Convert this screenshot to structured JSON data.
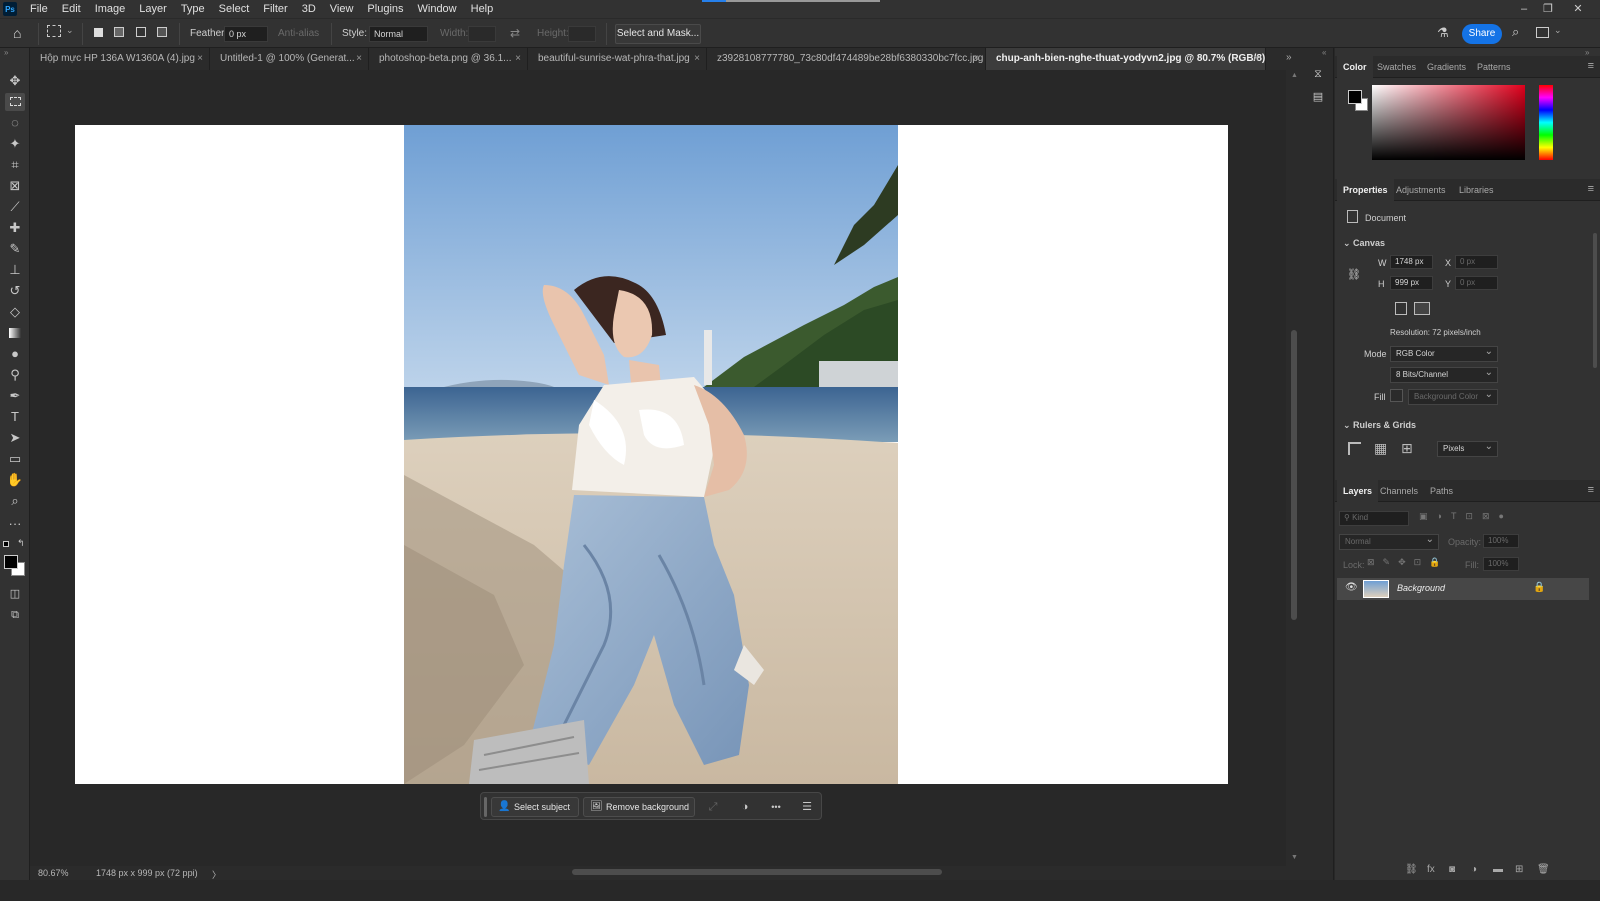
{
  "menu": {
    "app_icon": "Ps",
    "items": [
      "File",
      "Edit",
      "Image",
      "Layer",
      "Type",
      "Select",
      "Filter",
      "3D",
      "View",
      "Plugins",
      "Window",
      "Help"
    ],
    "window_controls": [
      "–",
      "❐",
      "✕"
    ]
  },
  "options_bar": {
    "feather_label": "Feather:",
    "feather_value": "0 px",
    "anti_alias_label": "Anti-alias",
    "style_label": "Style:",
    "style_value": "Normal",
    "width_label": "Width:",
    "height_label": "Height:",
    "select_mask_label": "Select and Mask...",
    "share_label": "Share"
  },
  "tabs": [
    {
      "label": "Hộp mực HP 136A W1360A (4).jpg",
      "active": false
    },
    {
      "label": "Untitled-1 @ 100% (Generat...",
      "active": false
    },
    {
      "label": "photoshop-beta.png @ 36.1...",
      "active": false
    },
    {
      "label": "beautiful-sunrise-wat-phra-that.jpg",
      "active": false
    },
    {
      "label": "z3928108777780_73c80df474489be28bf6380330bc7fcc.jpg",
      "active": false
    },
    {
      "label": "chup-anh-bien-nghe-thuat-yodyvn2.jpg @ 80.7% (RGB/8) *",
      "active": true
    }
  ],
  "tab_close": "×",
  "status": {
    "zoom": "80.67%",
    "doc_info": "1748 px x 999 px (72 ppi)",
    "arrow": "〉"
  },
  "taskbar": {
    "select_subject": "Select subject",
    "remove_background": "Remove background",
    "more": "•••"
  },
  "color_panel": {
    "tabs": [
      "Color",
      "Swatches",
      "Gradients",
      "Patterns"
    ],
    "foreground": "#000000",
    "background": "#ffffff",
    "hue_color": "#e0001c"
  },
  "properties_panel": {
    "tabs": [
      "Properties",
      "Adjustments",
      "Libraries"
    ],
    "document_label": "Document",
    "canvas_section": "Canvas",
    "w_label": "W",
    "w_value": "1748 px",
    "h_label": "H",
    "h_value": "999 px",
    "x_label": "X",
    "x_placeholder": "0 px",
    "y_label": "Y",
    "y_placeholder": "0 px",
    "resolution": "Resolution: 72 pixels/inch",
    "mode_label": "Mode",
    "mode_value": "RGB Color",
    "bits_value": "8 Bits/Channel",
    "fill_label": "Fill",
    "fill_value": "Background Color",
    "rulers_section": "Rulers & Grids",
    "units_value": "Pixels"
  },
  "layers_panel": {
    "tabs": [
      "Layers",
      "Channels",
      "Paths"
    ],
    "kind_placeholder": "Kind",
    "blend_mode": "Normal",
    "opacity_label": "Opacity:",
    "opacity_value": "100%",
    "lock_label": "Lock:",
    "fill_label": "Fill:",
    "fill_value": "100%",
    "layers": [
      {
        "name": "Background",
        "visible": true,
        "locked": true
      }
    ]
  }
}
